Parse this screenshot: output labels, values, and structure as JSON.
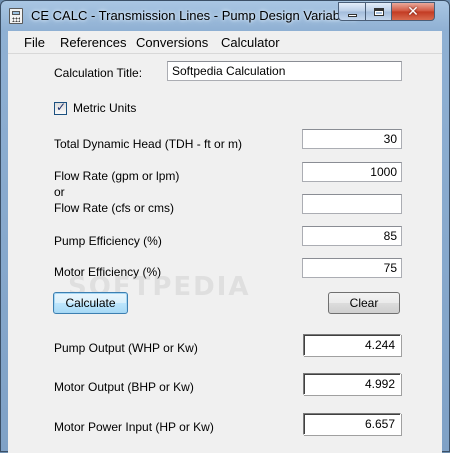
{
  "window": {
    "title": "CE CALC - Transmission Lines - Pump Design Variables",
    "app_icon": "calculator-icon",
    "controls": {
      "minimize": "minimize-icon",
      "maximize": "maximize-icon",
      "close": "close-icon",
      "close_glyph": "✕"
    }
  },
  "menu": [
    "File",
    "References",
    "Conversions",
    "Calculator"
  ],
  "form": {
    "calc_title": {
      "label": "Calculation Title:",
      "value": "Softpedia Calculation"
    },
    "metric_units": {
      "label": "Metric Units",
      "checked": true,
      "check_glyph": "✓"
    },
    "tdh": {
      "label": "Total Dynamic Head (TDH - ft or m)",
      "value": "30"
    },
    "flow_rate_gpm": {
      "label": "Flow Rate (gpm or lpm)",
      "value": "1000"
    },
    "or_label": "or",
    "flow_rate_cfs": {
      "label": "Flow Rate (cfs or cms)",
      "value": ""
    },
    "pump_efficiency": {
      "label": "Pump Efficiency (%)",
      "value": "85"
    },
    "motor_efficiency": {
      "label": "Motor Efficiency (%)",
      "value": "75"
    }
  },
  "buttons": {
    "calculate": "Calculate",
    "clear": "Clear"
  },
  "results": {
    "pump_output": {
      "label": "Pump Output (WHP or Kw)",
      "value": "4.244"
    },
    "motor_output": {
      "label": "Motor Output (BHP or Kw)",
      "value": "4.992"
    },
    "motor_power_input": {
      "label": "Motor Power Input (HP or Kw)",
      "value": "6.657"
    }
  },
  "watermark": "SOFTPEDIA"
}
